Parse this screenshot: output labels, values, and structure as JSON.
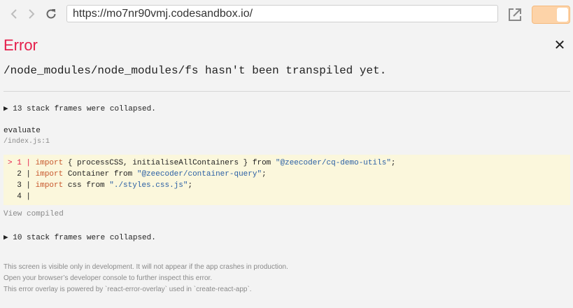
{
  "browser": {
    "url": "https://mo7nr90vmj.codesandbox.io/",
    "back_icon": "arrow-left-icon",
    "forward_icon": "arrow-right-icon",
    "reload_icon": "reload-icon",
    "open_icon": "open-external-icon",
    "toggle_color": "#fdd3a8"
  },
  "error": {
    "title": "Error",
    "close_symbol": "✕",
    "message": "/node_modules/node_modules/fs hasn't been transpiled yet.",
    "title_color": "#e51f4b"
  },
  "stack": {
    "collapsed_top": "▶ 13 stack frames were collapsed.",
    "frame_function": "evaluate",
    "frame_file": "/index.js:1",
    "code_lines": [
      {
        "marker": "> ",
        "num": "1",
        "sep": " | ",
        "kw1": "import",
        "mid": " { processCSS, initialiseAllContainers } from ",
        "str": "\"@zeecoder/cq-demo-utils\"",
        "end": ";"
      },
      {
        "marker": "  ",
        "num": "2",
        "sep": " | ",
        "kw1": "import",
        "mid": " Container from ",
        "str": "\"@zeecoder/container-query\"",
        "end": ";"
      },
      {
        "marker": "  ",
        "num": "3",
        "sep": " | ",
        "kw1": "import",
        "mid": " css from ",
        "str": "\"./styles.css.js\"",
        "end": ";"
      },
      {
        "marker": "  ",
        "num": "4",
        "sep": " |",
        "kw1": "",
        "mid": "",
        "str": "",
        "end": ""
      }
    ],
    "view_compiled": "View compiled",
    "collapsed_bottom": "▶ 10 stack frames were collapsed."
  },
  "footer": {
    "line1": "This screen is visible only in development. It will not appear if the app crashes in production.",
    "line2": "Open your browser’s developer console to further inspect this error.",
    "line3": "This error overlay is powered by `react-error-overlay` used in `create-react-app`."
  }
}
